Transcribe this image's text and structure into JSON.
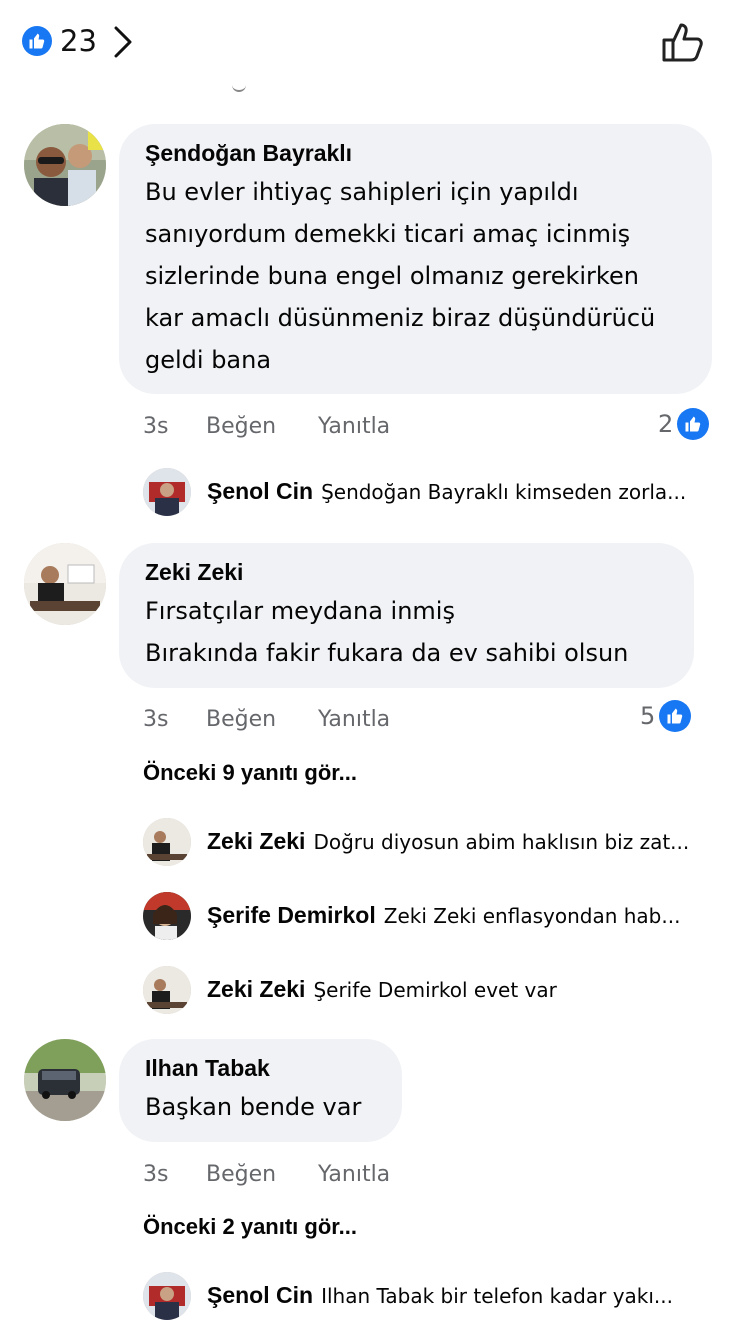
{
  "header": {
    "like_count": "23"
  },
  "comments": [
    {
      "author": "Şendoğan Bayraklı",
      "lines": [
        "Bu evler ihtiyaç sahipleri için yapıldı",
        "sanıyordum demekki ticari amaç icinmiş",
        "sizlerinde buna engel olmanız gerekirken",
        "kar amaclı düsünmeniz biraz düşündürücü",
        "geldi bana"
      ],
      "time": "3s",
      "like_label": "Beğen",
      "reply_label": "Yanıtla",
      "reaction_count": "2",
      "replies": [
        {
          "name": "Şenol Cin",
          "text": "Şendoğan Bayraklı kimseden zorla..."
        }
      ]
    },
    {
      "author": "Zeki Zeki",
      "lines": [
        "Fırsatçılar meydana inmiş",
        "Bırakında fakir fukara da ev sahibi olsun"
      ],
      "time": "3s",
      "like_label": "Beğen",
      "reply_label": "Yanıtla",
      "reaction_count": "5",
      "previous_replies": "Önceki 9 yanıtı gör...",
      "replies": [
        {
          "name": "Zeki Zeki",
          "text": "Doğru diyosun abim haklısın biz zat..."
        },
        {
          "name": "Şerife Demirkol",
          "text": "Zeki Zeki enflasyondan hab..."
        },
        {
          "name": "Zeki Zeki",
          "text": "Şerife Demirkol evet var"
        }
      ]
    },
    {
      "author": "Ilhan Tabak",
      "lines": [
        "Başkan bende var"
      ],
      "time": "3s",
      "like_label": "Beğen",
      "reply_label": "Yanıtla",
      "previous_replies": "Önceki 2 yanıtı gör...",
      "replies": [
        {
          "name": "Şenol Cin",
          "text": "Ilhan Tabak bir telefon kadar yakı..."
        }
      ]
    }
  ],
  "icons": {
    "reaction": "like-icon",
    "back": "chevron-right-icon",
    "like_button": "thumbs-up-outline-icon"
  },
  "colors": {
    "accent": "#1877f2",
    "bubble": "#f0f2f5",
    "meta": "#65676b"
  }
}
